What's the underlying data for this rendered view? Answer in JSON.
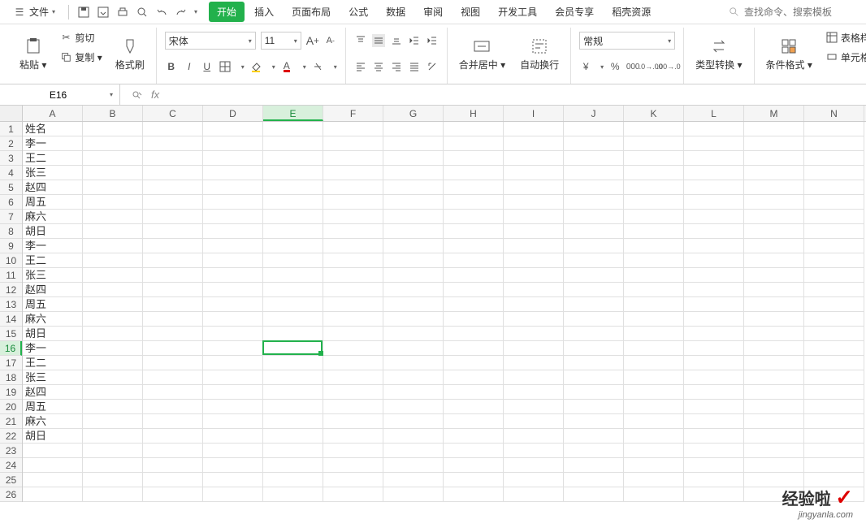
{
  "menu": {
    "file": "文件",
    "tabs": [
      "开始",
      "插入",
      "页面布局",
      "公式",
      "数据",
      "审阅",
      "视图",
      "开发工具",
      "会员专享",
      "稻壳资源"
    ],
    "active_tab": 0,
    "search_placeholder": "查找命令、搜索模板"
  },
  "ribbon": {
    "paste": "粘贴",
    "cut": "剪切",
    "copy": "复制",
    "format_painter": "格式刷",
    "font": "宋体",
    "font_size": "11",
    "merge": "合并居中",
    "wrap": "自动换行",
    "number_format": "常规",
    "type_convert": "类型转换",
    "cond_format": "条件格式",
    "table_style": "表格样式",
    "cell_style": "单元格样式"
  },
  "namebox": "E16",
  "columns": [
    "A",
    "B",
    "C",
    "D",
    "E",
    "F",
    "G",
    "H",
    "I",
    "J",
    "K",
    "L",
    "M",
    "N"
  ],
  "selected_col": 4,
  "selected_row": 15,
  "row_count": 26,
  "data": [
    "姓名",
    "李一",
    "王二",
    "张三",
    "赵四",
    "周五",
    "麻六",
    "胡日",
    "李一",
    "王二",
    "张三",
    "赵四",
    "周五",
    "麻六",
    "胡日",
    "李一",
    "王二",
    "张三",
    "赵四",
    "周五",
    "麻六",
    "胡日"
  ],
  "watermark": {
    "text": "经验啦",
    "url": "jingyanla.com"
  }
}
